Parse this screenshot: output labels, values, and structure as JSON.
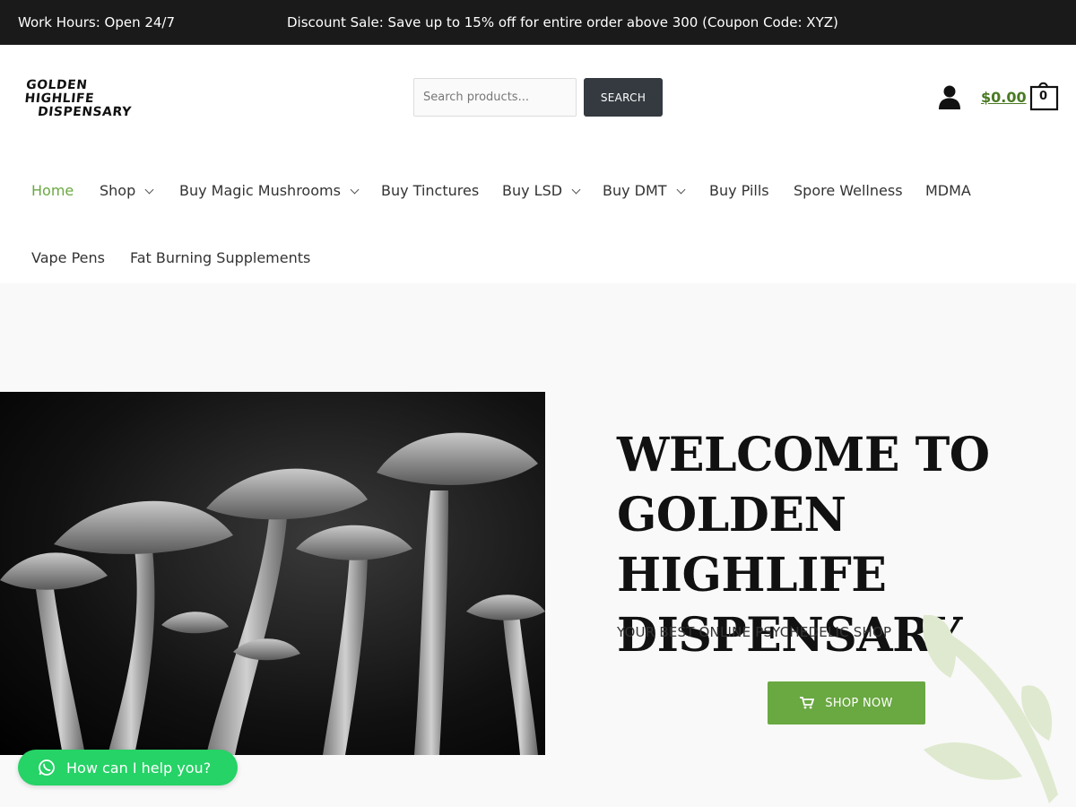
{
  "topbar": {
    "hours": "Work Hours: Open 24/7",
    "promo": "Discount Sale: Save up to 15% off for entire order above 300 (Coupon Code: XYZ)"
  },
  "header": {
    "logo_line1": "GOLDEN HIGHLIFE",
    "logo_line2": "DISPENSARY",
    "search_placeholder": "Search products...",
    "search_button": "SEARCH",
    "cart_total": "$0.00",
    "cart_count": "0"
  },
  "nav": {
    "items": [
      {
        "label": "Home",
        "active": true
      },
      {
        "label": "Shop"
      },
      {
        "label": "Buy Magic Mushrooms"
      },
      {
        "label": "Buy Tinctures"
      },
      {
        "label": "Buy LSD"
      },
      {
        "label": "Buy DMT"
      },
      {
        "label": "Buy Pills"
      },
      {
        "label": "Spore Wellness"
      },
      {
        "label": "MDMA"
      },
      {
        "label": "Vape Pens"
      },
      {
        "label": "Fat Burning Supplements"
      }
    ]
  },
  "hero": {
    "title_line1": "WELCOME TO",
    "title_line2": "GOLDEN HIGHLIFE",
    "title_line3": "DISPENSARY",
    "subtitle": "YOUR BEST ONLINE PSYCHEDELIC SHOP",
    "cta": "SHOP NOW"
  },
  "chat": {
    "label": "How can I help you?"
  },
  "colors": {
    "accent": "#6aa842",
    "topbar_bg": "#1a1a1a",
    "search_button_bg": "#343a40",
    "whatsapp": "#25d366"
  },
  "icons": [
    "user-icon",
    "shopping-bag-icon",
    "chevron-down-icon",
    "shopping-cart-icon",
    "whatsapp-icon",
    "leaf-decoration"
  ]
}
